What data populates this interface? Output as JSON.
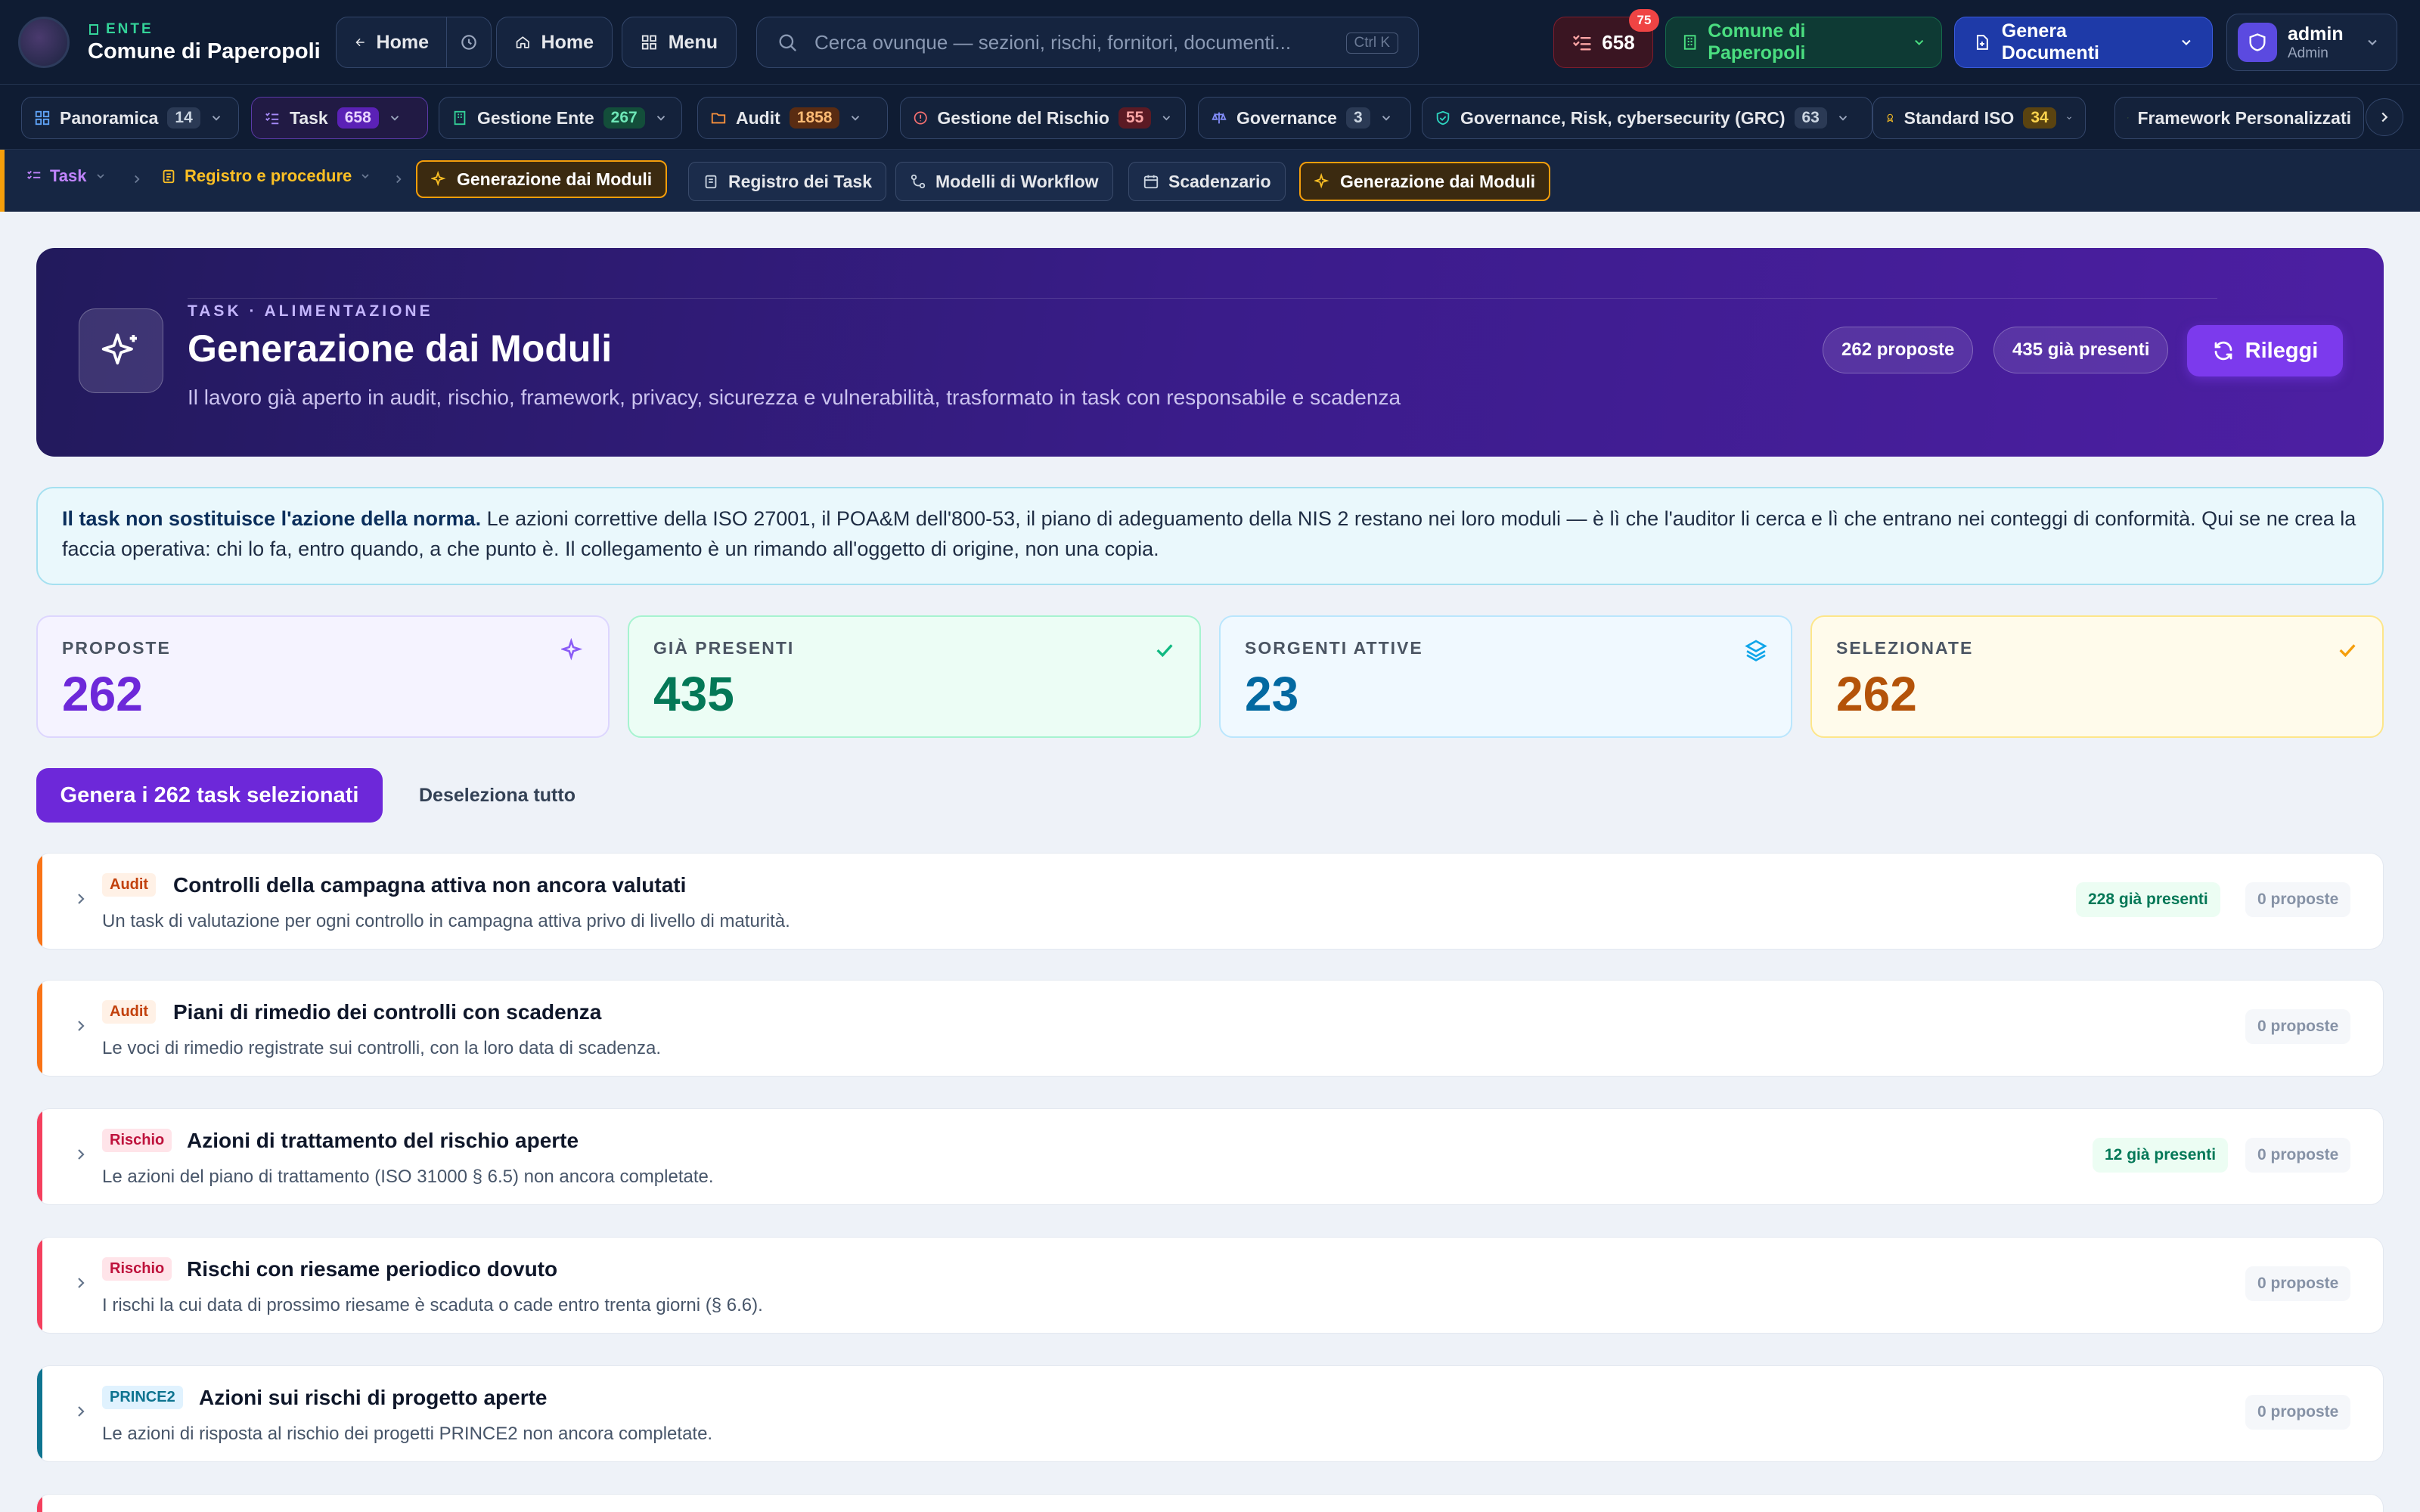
{
  "topbar": {
    "ente_label": "ENTE",
    "ente_name": "Comune di Paperopoli",
    "back_home": "Home",
    "home": "Home",
    "menu": "Menu",
    "search_placeholder": "Cerca ovunque — sezioni, rischi, fornitori, documenti...",
    "search_shortcut": "Ctrl K",
    "task_count": "658",
    "notif_badge": "75",
    "org_selector": "Comune di Paperopoli",
    "genera_documenti": "Genera Documenti",
    "user_name": "admin",
    "user_role": "Admin"
  },
  "modules": [
    {
      "label": "Panoramica",
      "count": "14"
    },
    {
      "label": "Task",
      "count": "658"
    },
    {
      "label": "Gestione Ente",
      "count": "267"
    },
    {
      "label": "Audit",
      "count": "1858"
    },
    {
      "label": "Gestione del Rischio",
      "count": "55"
    },
    {
      "label": "Governance",
      "count": "3"
    },
    {
      "label": "Governance, Risk, cybersecurity (GRC)",
      "count": "63"
    },
    {
      "label": "Standard ISO",
      "count": "34"
    },
    {
      "label": "Framework Personalizzati",
      "count": ""
    }
  ],
  "breadcrumb": {
    "task": "Task",
    "registro": "Registro e procedure",
    "current": "Generazione dai Moduli"
  },
  "subtabs": [
    "Registro dei Task",
    "Modelli di Workflow",
    "Scadenzario",
    "Generazione dai Moduli"
  ],
  "hero": {
    "kicker": "TASK · ALIMENTAZIONE",
    "title": "Generazione dai Moduli",
    "subtitle": "Il lavoro già aperto in audit, rischio, framework, privacy, sicurezza e vulnerabilità, trasformato in task con responsabile e scadenza",
    "pill_proposte": "262 proposte",
    "pill_presenti": "435 già presenti",
    "rileggi": "Rileggi"
  },
  "note": {
    "bold": "Il task non sostituisce l'azione della norma.",
    "text": " Le azioni correttive della ISO 27001, il POA&M dell'800-53, il piano di adeguamento della NIS 2 restano nei loro moduli — è lì che l'auditor li cerca e lì che entrano nei conteggi di conformità. Qui se ne crea la faccia operativa: chi lo fa, entro quando, a che punto è. Il collegamento è un rimando all'oggetto di origine, non una copia."
  },
  "stats": {
    "proposte": {
      "label": "PROPOSTE",
      "value": "262"
    },
    "presenti": {
      "label": "GIÀ PRESENTI",
      "value": "435"
    },
    "sorgenti": {
      "label": "SORGENTI ATTIVE",
      "value": "23"
    },
    "selezionate": {
      "label": "SELEZIONATE",
      "value": "262"
    }
  },
  "actions": {
    "genera": "Genera i 262 task selezionati",
    "deseleziona": "Deseleziona tutto"
  },
  "sources": [
    {
      "tag": "Audit",
      "title": "Controlli della campagna attiva non ancora valutati",
      "desc": "Un task di valutazione per ogni controllo in campagna attiva privo di livello di maturità.",
      "present": "228 già presenti",
      "proposte": "0 proposte"
    },
    {
      "tag": "Audit",
      "title": "Piani di rimedio dei controlli con scadenza",
      "desc": "Le voci di rimedio registrate sui controlli, con la loro data di scadenza.",
      "present": "",
      "proposte": "0 proposte"
    },
    {
      "tag": "Rischio",
      "title": "Azioni di trattamento del rischio aperte",
      "desc": "Le azioni del piano di trattamento (ISO 31000 § 6.5) non ancora completate.",
      "present": "12 già presenti",
      "proposte": "0 proposte"
    },
    {
      "tag": "Rischio",
      "title": "Rischi con riesame periodico dovuto",
      "desc": "I rischi la cui data di prossimo riesame è scaduta o cade entro trenta giorni (§ 6.6).",
      "present": "",
      "proposte": "0 proposte"
    },
    {
      "tag": "PRINCE2",
      "title": "Azioni sui rischi di progetto aperte",
      "desc": "Le azioni di risposta al rischio dei progetti PRINCE2 non ancora completate.",
      "present": "",
      "proposte": "0 proposte"
    }
  ]
}
